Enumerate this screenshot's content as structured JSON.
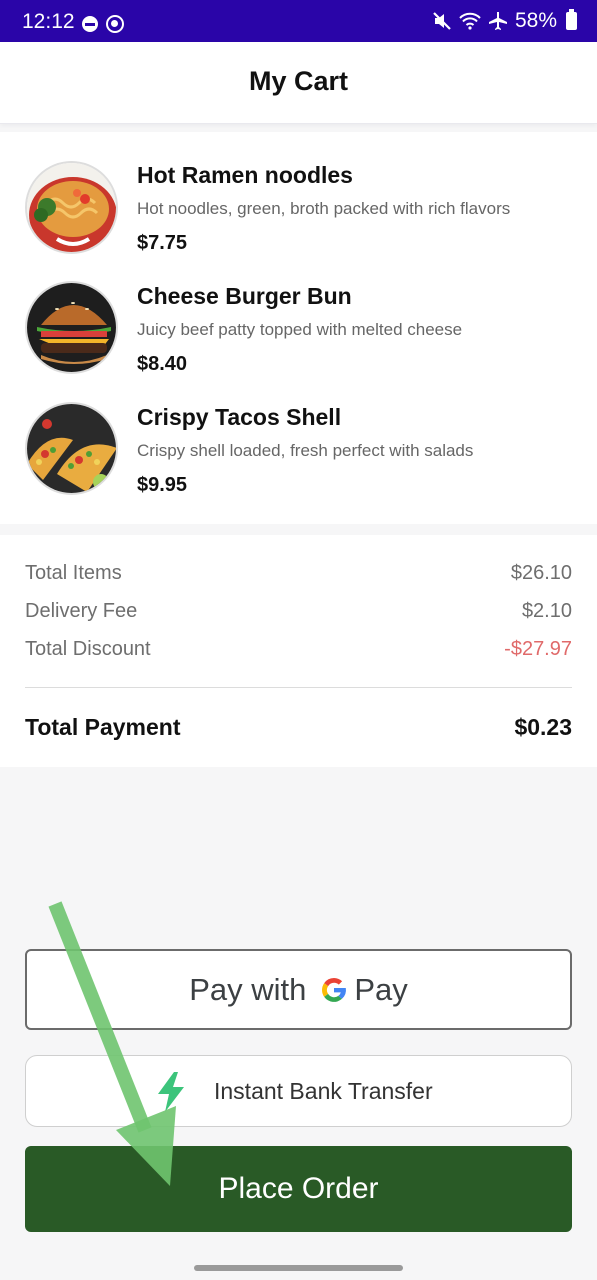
{
  "status_bar": {
    "time": "12:12",
    "battery": "58%",
    "icons": [
      "dnd-icon",
      "app-notification-icon",
      "mute-icon",
      "wifi-calling-icon",
      "airplane-icon",
      "battery-icon"
    ]
  },
  "header": {
    "title": "My Cart"
  },
  "cart": {
    "items": [
      {
        "name": "Hot Ramen noodles",
        "description": "Hot noodles, green, broth packed with rich flavors",
        "price": "$7.75",
        "image": "ramen-image"
      },
      {
        "name": "Cheese Burger Bun",
        "description": "Juicy beef patty topped with melted cheese",
        "price": "$8.40",
        "image": "burger-image"
      },
      {
        "name": "Crispy Tacos Shell",
        "description": "Crispy shell loaded, fresh perfect with salads",
        "price": "$9.95",
        "image": "tacos-image"
      }
    ]
  },
  "summary": {
    "total_items": {
      "label": "Total Items",
      "value": "$26.10"
    },
    "delivery_fee": {
      "label": "Delivery Fee",
      "value": "$2.10"
    },
    "total_discount": {
      "label": "Total Discount",
      "value": "-$27.97"
    },
    "total_payment": {
      "label": "Total Payment",
      "value": "$0.23"
    }
  },
  "payment": {
    "gpay_prefix": "Pay with",
    "gpay_brand": "Pay",
    "bank_transfer": "Instant Bank Transfer",
    "place_order": "Place Order"
  },
  "colors": {
    "status_bar": "#2a05a8",
    "place_order": "#295a26",
    "discount": "#e06a6a",
    "annotation_arrow": "#6fc46f"
  }
}
